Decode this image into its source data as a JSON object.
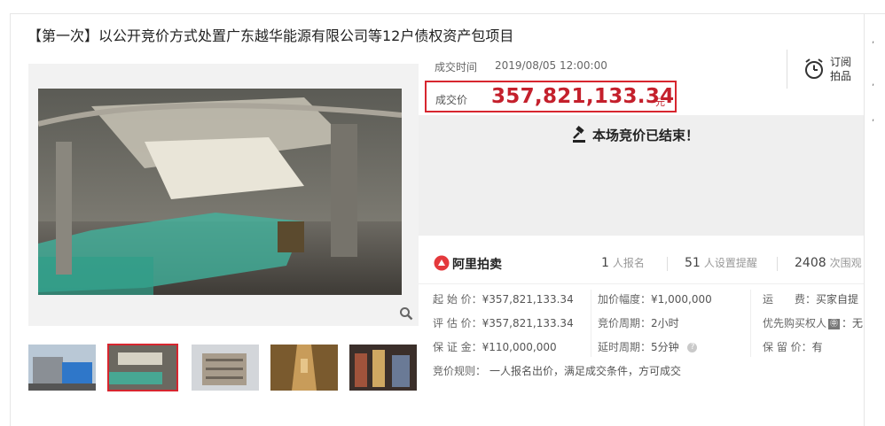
{
  "title": "【第一次】以公开竞价方式处置广东越华能源有限公司等12户债权资产包项目",
  "deal": {
    "time_label": "成交时间",
    "time_value": "2019/08/05 12:00:00",
    "price_label": "成交价",
    "price_value": "357,821,133.34",
    "price_unit": "元"
  },
  "subscribe": {
    "label_line1": "订阅",
    "label_line2": "拍品"
  },
  "status_text": "本场竞价已结束！",
  "platform": {
    "name": "阿里拍卖"
  },
  "stats": [
    {
      "value": "1",
      "unit": "人报名"
    },
    {
      "value": "51",
      "unit": "人设置提醒"
    },
    {
      "value": "2408",
      "unit": "次围观"
    }
  ],
  "info": {
    "col1": [
      {
        "label": "起 始 价：",
        "value": "¥357,821,133.34"
      },
      {
        "label": "评 估 价：",
        "value": "¥357,821,133.34"
      },
      {
        "label": "保 证 金：",
        "value": "¥110,000,000"
      }
    ],
    "col2": [
      {
        "label": "加价幅度：",
        "value": "¥1,000,000"
      },
      {
        "label": "竞价周期：",
        "value": "2小时"
      },
      {
        "label": "延时周期：",
        "value": "5分钟"
      }
    ],
    "col3": [
      {
        "label": "运　　费：",
        "value": "买家自提"
      },
      {
        "label": "优先购买权人",
        "badge": "㊥",
        "value": "：无"
      },
      {
        "label": "保 留 价：",
        "value": "有"
      }
    ],
    "rule_label": "竞价规则：",
    "rule_value": "一人报名出价，满足成交条件，方可成交"
  },
  "icons": {
    "subscribe": "alarm-clock-icon",
    "status": "gavel-icon",
    "zoom": "magnifier-icon",
    "help": "question-icon"
  },
  "colors": {
    "accent": "#c4202c",
    "border_highlight": "#d7262f"
  }
}
